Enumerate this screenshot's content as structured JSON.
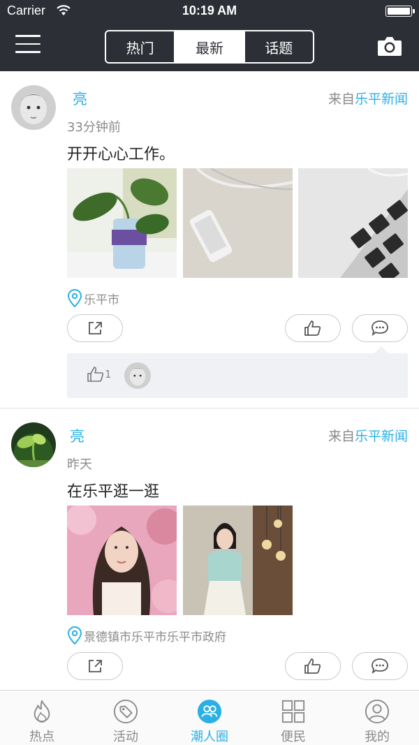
{
  "status_bar": {
    "carrier": "Carrier",
    "time": "10:19 AM"
  },
  "nav": {
    "tabs": [
      {
        "label": "热门",
        "active": false
      },
      {
        "label": "最新",
        "active": true
      },
      {
        "label": "话题",
        "active": false
      }
    ],
    "menu_icon": "hamburger-menu-icon",
    "camera_icon": "camera-icon"
  },
  "posts": [
    {
      "username": "亮",
      "source_prefix": "来自",
      "source_name": "乐平新闻",
      "timestamp": "33分钟前",
      "content": "开开心心工作。",
      "photos": [
        "plant-in-bottle-photo",
        "phone-on-desk-photo",
        "laptop-keyboard-photo"
      ],
      "location": "乐平市",
      "likes_count": "1"
    },
    {
      "username": "亮",
      "source_prefix": "来自",
      "source_name": "乐平新闻",
      "timestamp": "昨天",
      "content": "在乐平逛一逛",
      "photos": [
        "woman-portrait-pink-photo",
        "woman-standing-lights-photo"
      ],
      "location": "景德镇市乐平市乐平市政府"
    }
  ],
  "tabbar": [
    {
      "label": "热点",
      "icon": "flame-icon",
      "active": false
    },
    {
      "label": "活动",
      "icon": "tag-icon",
      "active": false
    },
    {
      "label": "潮人圈",
      "icon": "people-icon",
      "active": true
    },
    {
      "label": "便民",
      "icon": "grid-icon",
      "active": false
    },
    {
      "label": "我的",
      "icon": "user-icon",
      "active": false
    }
  ],
  "colors": {
    "accent": "#2ab0e6",
    "navbar": "#2c2f36",
    "muted": "#8a8a8a"
  }
}
